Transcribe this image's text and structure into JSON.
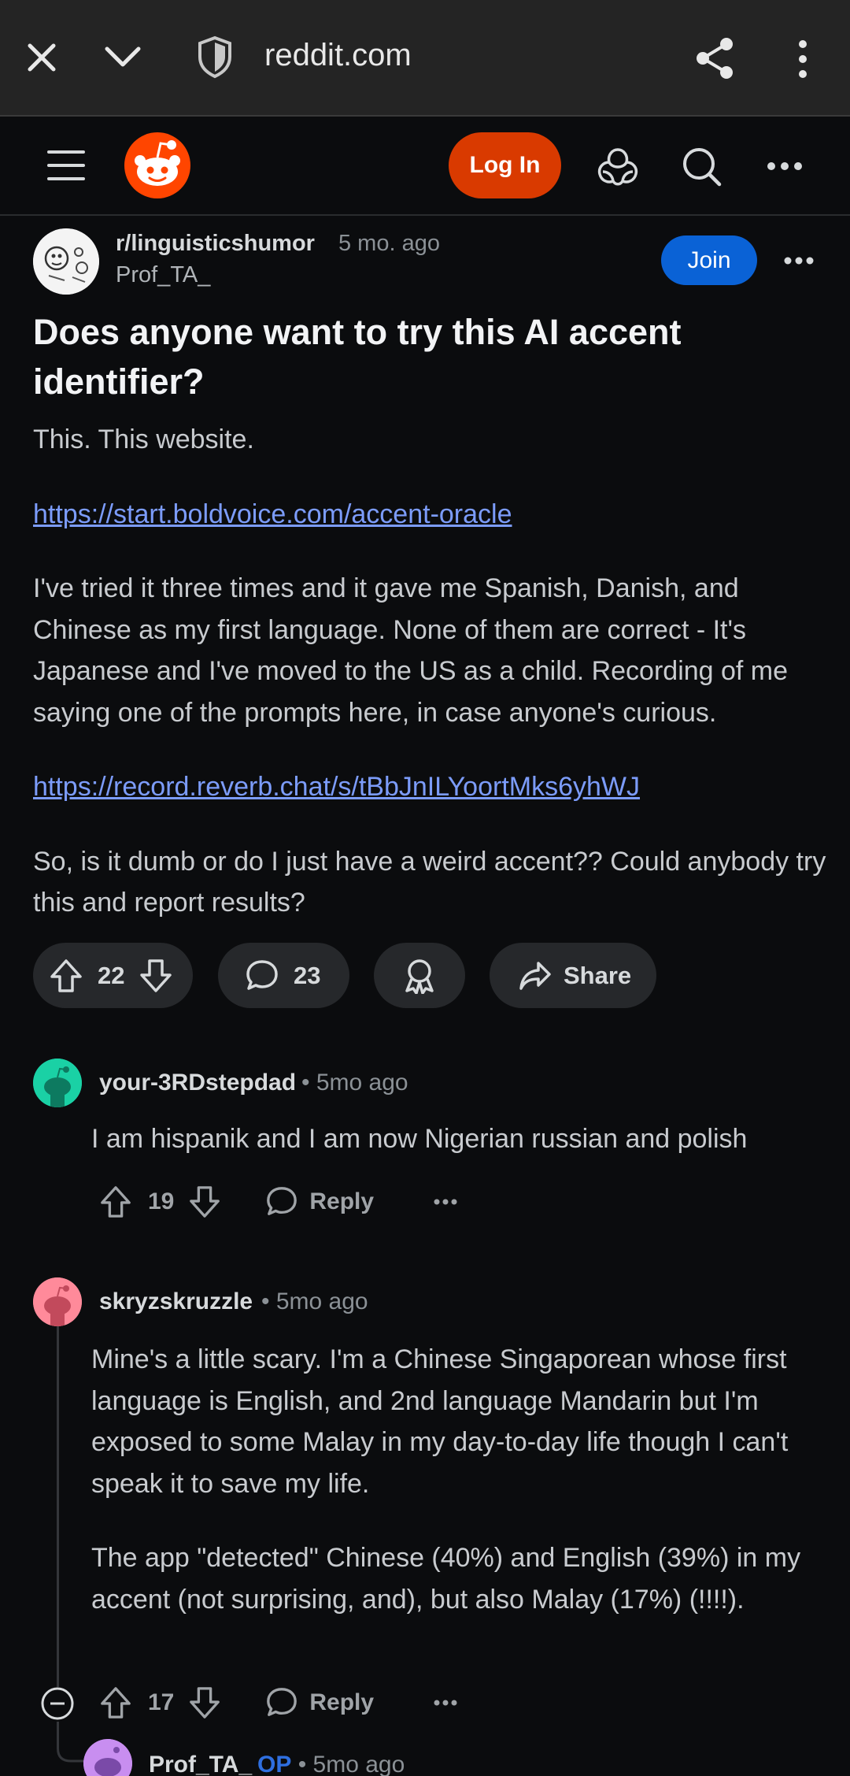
{
  "browser": {
    "url": "reddit.com"
  },
  "header": {
    "login_label": "Log In"
  },
  "post": {
    "subreddit": "r/linguisticshumor",
    "age": "5 mo. ago",
    "author": "Prof_TA_",
    "join_label": "Join",
    "title": "Does anyone want to try this AI accent identifier?",
    "body_intro": "This. This website.",
    "link1": "https://start.boldvoice.com/accent-oracle",
    "body_story": "I've tried it three times and it gave me Spanish, Danish, and Chinese as my first language. None of them are correct - It's Japanese and I've moved to the US as a child. Recording of me saying one of the prompts here, in case anyone's curious.",
    "link2": "https://record.reverb.chat/s/tBbJnILYoortMks6yhWJ",
    "body_question": "So, is it dumb or do I just have a weird accent?? Could anybody try this and report results?",
    "votes": "22",
    "comments": "23",
    "share_label": "Share"
  },
  "comments": [
    {
      "user": "your-3RDstepdad",
      "time": "5mo ago",
      "body": "I am hispanik and I am now Nigerian russian and polish",
      "votes": "19",
      "reply_label": "Reply",
      "avatar_color": "#1ad1a5"
    },
    {
      "user": "skryzskruzzle",
      "time": "5mo ago",
      "body_p1": "Mine's a little scary. I'm a Chinese Singaporean whose first language is English, and 2nd language Mandarin but I'm exposed to some Malay in my day-to-day life though I can't speak it to save my life.",
      "body_p2": "The app \"detected\" Chinese (40%) and English (39%) in my accent (not surprising, and), but also Malay (17%) (!!!!).",
      "votes": "17",
      "reply_label": "Reply",
      "avatar_color": "#ff8a9a"
    },
    {
      "user": "Prof_TA_",
      "op_tag": "OP",
      "time": "5mo ago",
      "avatar_color": "#c88ef0"
    }
  ],
  "colors": {
    "accent_orange": "#d93a00",
    "join_blue": "#0a62d6",
    "link_blue": "#7c9cfb"
  }
}
